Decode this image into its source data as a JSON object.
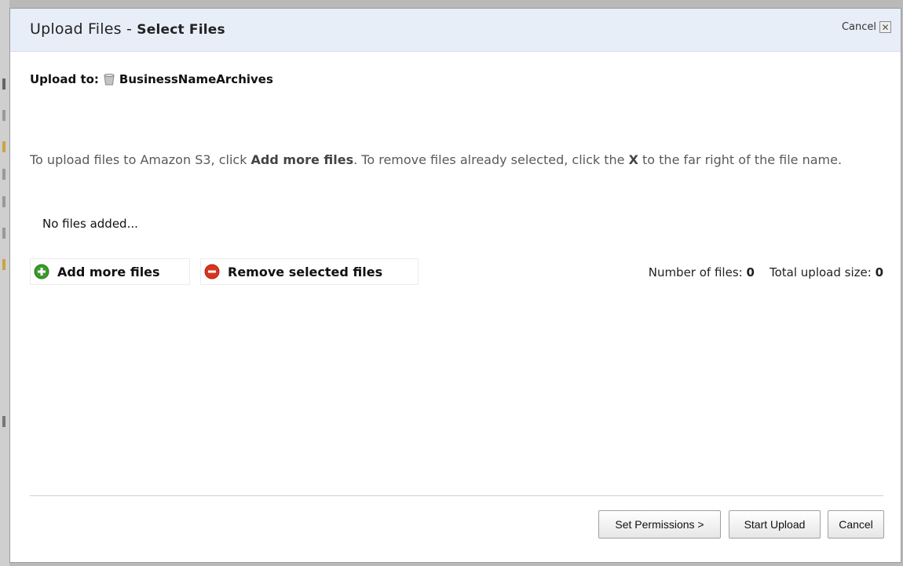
{
  "dialog": {
    "title": "Upload Files",
    "title_separator": " - ",
    "subtitle": "Select Files",
    "cancel_label": "Cancel",
    "close_icon": "close-icon"
  },
  "upload_to": {
    "label": "Upload to:",
    "bucket_icon": "bucket-icon",
    "bucket_name": "BusinessNameArchives"
  },
  "instructions": {
    "part1": "To upload files to Amazon S3, click ",
    "bold1": "Add more files",
    "part2": ". To remove files already selected, click the ",
    "bold2": "X",
    "part3": " to the far right of the file name."
  },
  "file_list": {
    "empty_text": "No files added..."
  },
  "actions": {
    "add_label": "Add more files",
    "add_icon": "plus-circle-icon",
    "remove_label": "Remove selected files",
    "remove_icon": "minus-circle-icon"
  },
  "counts": {
    "number_label": "Number of files:",
    "number_value": "0",
    "size_label": "Total upload size:",
    "size_value": "0"
  },
  "footer": {
    "set_permissions_label": "Set Permissions >",
    "start_upload_label": "Start Upload",
    "cancel_label": "Cancel"
  },
  "colors": {
    "titlebar": "#e8eef8",
    "add_icon": "#3a9a2c",
    "remove_icon": "#d8341f"
  }
}
